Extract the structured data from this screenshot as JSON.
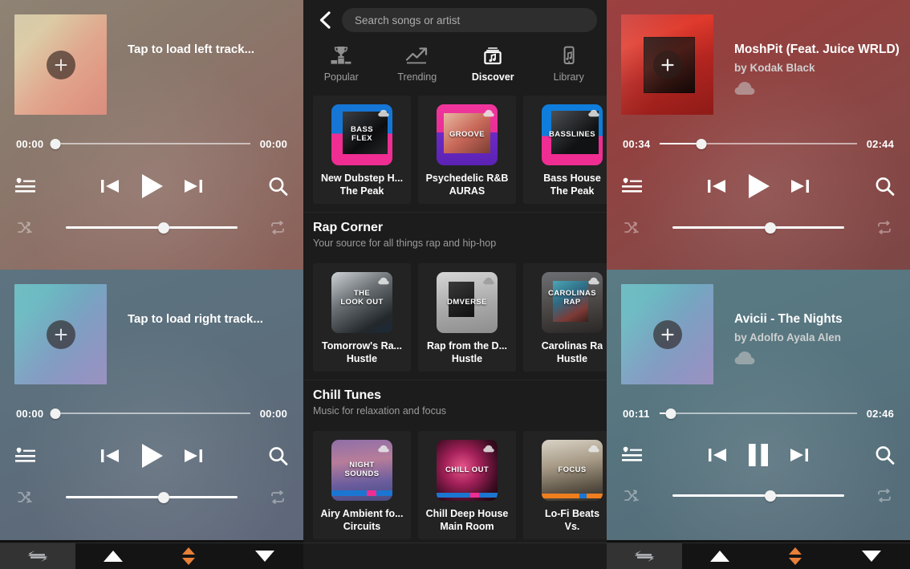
{
  "decks": {
    "left_top": {
      "name": "deck-left-top",
      "title": "Tap to load left track...",
      "artist": "",
      "elapsed": "00:00",
      "duration": "00:00",
      "progress_pct": 1,
      "volume_pct": 57,
      "play_state": "play",
      "art_plus_label": "+"
    },
    "left_bottom": {
      "name": "deck-left-bottom",
      "title": "Tap to load right track...",
      "artist": "",
      "elapsed": "00:00",
      "duration": "00:00",
      "progress_pct": 1,
      "volume_pct": 57,
      "play_state": "play",
      "art_plus_label": "+"
    },
    "right_top": {
      "name": "deck-right-top",
      "title": "MoshPit (Feat. Juice WRLD)",
      "artist": "by Kodak Black",
      "elapsed": "00:34",
      "duration": "02:44",
      "progress_pct": 21,
      "volume_pct": 57,
      "play_state": "play",
      "art_plus_label": "+",
      "source_icon": "soundcloud-cloud-icon"
    },
    "right_bottom": {
      "name": "deck-right-bottom",
      "title": "Avicii - The Nights",
      "artist": "by Adolfo Ayala Alen",
      "elapsed": "00:11",
      "duration": "02:46",
      "progress_pct": 6,
      "volume_pct": 57,
      "play_state": "pause",
      "art_plus_label": "+",
      "source_icon": "soundcloud-cloud-icon"
    }
  },
  "transport_icons": {
    "playlist": "playlist-heart-icon",
    "prev": "skip-previous-icon",
    "play": "play-icon",
    "pause": "pause-icon",
    "next": "skip-next-icon",
    "search": "search-icon",
    "shuffle": "shuffle-icon",
    "repeat": "repeat-icon"
  },
  "browser": {
    "back_icon": "back-chevron-icon",
    "search": {
      "placeholder": "Search songs or artist",
      "value": ""
    },
    "tabs": [
      {
        "label": "Popular",
        "icon": "trophy-podium-icon",
        "active": false
      },
      {
        "label": "Trending",
        "icon": "trend-line-arrow-icon",
        "active": false
      },
      {
        "label": "Discover",
        "icon": "music-box-icon",
        "active": true
      },
      {
        "label": "Library",
        "icon": "phone-music-icon",
        "active": false
      }
    ],
    "sections": [
      {
        "title": "",
        "subtitle": "",
        "cards": [
          {
            "title": "New Dubstep H...",
            "subtitle": "The Peak",
            "art_caption": "BASS\nFLEX",
            "art_class": "th-bassflex"
          },
          {
            "title": "Psychedelic R&B",
            "subtitle": "AURAS",
            "art_caption": "GROOVE",
            "art_class": "th-groove"
          },
          {
            "title": "Bass House",
            "subtitle": "The Peak",
            "art_caption": "BASSLINES",
            "art_class": "th-basslines"
          }
        ]
      },
      {
        "title": "Rap Corner",
        "subtitle": "Your source for all things rap and hip-hop",
        "cards": [
          {
            "title": "Tomorrow's Ra...",
            "subtitle": "Hustle",
            "art_caption": "THE\nLOOK OUT",
            "art_class": "th-lookout"
          },
          {
            "title": "Rap from the D...",
            "subtitle": "Hustle",
            "art_caption": "DMVERSE",
            "art_class": "th-dmverse"
          },
          {
            "title": "Carolinas Ra",
            "subtitle": "Hustle",
            "art_caption": "CAROLINAS\nRAP",
            "art_class": "th-carolinas"
          }
        ]
      },
      {
        "title": "Chill Tunes",
        "subtitle": "Music for relaxation and focus",
        "cards": [
          {
            "title": "Airy Ambient fo...",
            "subtitle": "Circuits",
            "art_caption": "NIGHT\nSOUNDS",
            "art_class": "th-night"
          },
          {
            "title": "Chill Deep House",
            "subtitle": "Main Room",
            "art_caption": "CHILL OUT",
            "art_class": "th-chillout"
          },
          {
            "title": "Lo-Fi Beats",
            "subtitle": "Vs.",
            "art_caption": "FOCUS",
            "art_class": "th-focus"
          }
        ]
      }
    ]
  },
  "navbar": {
    "left": [
      {
        "icon": "swap-arrows-icon",
        "accent": "#b8bcc0"
      },
      {
        "icon": "triangle-up-icon",
        "accent": "#ffffff"
      },
      {
        "icon": "triangle-up-down-icon",
        "accent": "#e8803a"
      },
      {
        "icon": "triangle-down-icon",
        "accent": "#ffffff"
      }
    ],
    "right": [
      {
        "icon": "swap-arrows-icon",
        "accent": "#b8bcc0"
      },
      {
        "icon": "triangle-up-icon",
        "accent": "#ffffff"
      },
      {
        "icon": "triangle-up-down-icon",
        "accent": "#e8803a"
      },
      {
        "icon": "triangle-down-icon",
        "accent": "#ffffff"
      }
    ]
  },
  "colors": {
    "accent_orange": "#e8803a",
    "browser_bg": "#1c1c1c",
    "card_bg": "#232323",
    "navbar_bg": "#141414"
  }
}
